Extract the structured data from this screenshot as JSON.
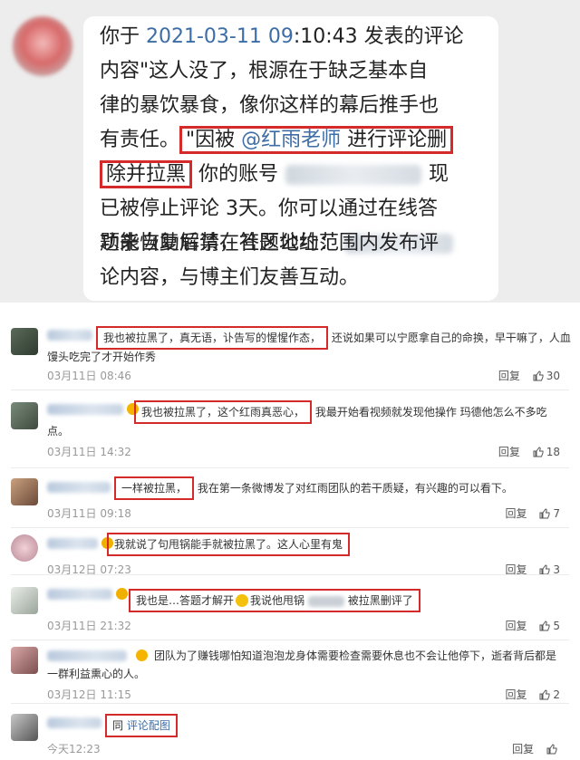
{
  "notice": {
    "line1_prefix": "你于 ",
    "timestamp": "2021-03-11 09",
    "line1_suffix": ":10:43 发表的评论",
    "line2": "内容\"这人没了，根源在于缺乏基本自",
    "line3": "律的暴饮暴食，像你这样的幕后推手也",
    "line4_prefix": "有责任。",
    "line4_box_start": "\"因被 ",
    "line4_mention": "@红雨老师",
    "line4_box_end": " 进行评论删",
    "line5_box": "除并拉黑",
    "line5_mid": "  你的账号",
    "line5_end": "现",
    "line6": "已被停止评论 3天。你可以通过在线答",
    "line7": "题来自助解禁，答题地址：",
    "line8": "功能恢复后请在社区公约范围内发布评",
    "line9": "论内容，与博主们友善互动。"
  },
  "comments": [
    {
      "boxed": "我也被拉黑了，真无语，讣告写的惺惺作态，",
      "rest": "还说如果可以宁愿拿自己的命换，早干嘛了，人血",
      "line2": "馒头吃完了才开始作秀",
      "time": "03月11日 08:46",
      "reply": "回复",
      "likes": "30"
    },
    {
      "boxed": "我也被拉黑了，这个红雨真恶心，",
      "rest": "我最开始看视频就发现他操作 玛德他怎么不多吃",
      "line2": "点。",
      "time": "03月11日 14:32",
      "reply": "回复",
      "likes": "18"
    },
    {
      "boxed": "一样被拉黑，",
      "rest": "我在第一条微博发了对红雨团队的若干质疑，有兴趣的可以看下。",
      "time": "03月11日 09:18",
      "reply": "回复",
      "likes": "7"
    },
    {
      "boxed": "我就说了句甩锅能手就被拉黑了。这人心里有鬼",
      "time": "03月12日 07:23",
      "reply": "回复",
      "likes": "3"
    },
    {
      "boxed_a": "我也是…答题才解开",
      "boxed_b": "我说他甩锅",
      "boxed_c": "被拉黑删评了",
      "time": "03月11日 21:32",
      "reply": "回复",
      "likes": "5"
    },
    {
      "text": "团队为了赚钱哪怕知道泡泡龙身体需要检查需要休息也不会让他停下，逝者背后都是",
      "line2": "一群利益熏心的人。",
      "time": "03月12日 11:15",
      "reply": "回复",
      "likes": "2"
    },
    {
      "prefix": "同 ",
      "link": "评论配图",
      "time": "今天12:23",
      "reply": "回复"
    }
  ],
  "icons": {
    "like": "thumbs-up-icon",
    "emoji": "smiley-icon"
  },
  "colors": {
    "highlight_box": "#d42a2a",
    "link": "#3d6da6"
  }
}
